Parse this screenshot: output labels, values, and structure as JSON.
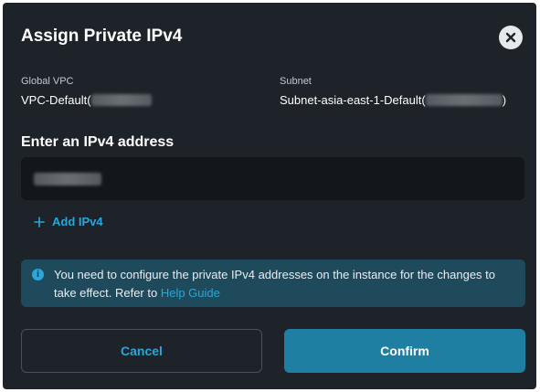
{
  "dialog": {
    "title": "Assign Private IPv4",
    "close_icon": "close-icon"
  },
  "fields": {
    "vpc_label": "Global VPC",
    "vpc_value": "VPC-Default(",
    "subnet_label": "Subnet",
    "subnet_value": "Subnet-asia-east-1-Default(",
    "subnet_value_suffix": ")"
  },
  "ipv4": {
    "section_title": "Enter an IPv4 address",
    "add_label": "Add IPv4",
    "add_icon": "plus-icon"
  },
  "notice": {
    "icon": "info-icon",
    "text": "You need to configure the private IPv4 addresses on the instance for the changes to take effect. Refer to ",
    "link": "Help Guide"
  },
  "actions": {
    "cancel_label": "Cancel",
    "confirm_label": "Confirm"
  },
  "colors": {
    "dialog_bg": "#1e2329",
    "accent": "#2aa6d8",
    "confirm_bg": "#1f7fa3",
    "notice_bg": "#1f4a5b"
  }
}
